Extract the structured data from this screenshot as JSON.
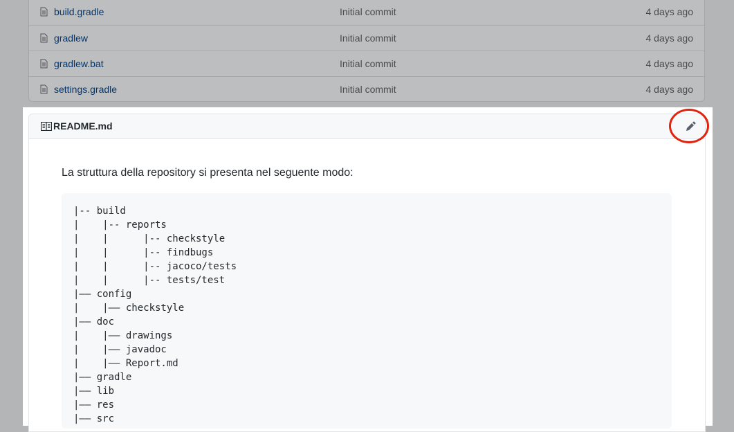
{
  "files": [
    {
      "name": "build.gradle",
      "message": "Initial commit",
      "age": "4 days ago"
    },
    {
      "name": "gradlew",
      "message": "Initial commit",
      "age": "4 days ago"
    },
    {
      "name": "gradlew.bat",
      "message": "Initial commit",
      "age": "4 days ago"
    },
    {
      "name": "settings.gradle",
      "message": "Initial commit",
      "age": "4 days ago"
    }
  ],
  "readme": {
    "title": "README.md",
    "intro": "La struttura della repository si presenta nel seguente modo:",
    "tree": "|-- build\n|    |-- reports\n|    |      |-- checkstyle\n|    |      |-- findbugs\n|    |      |-- jacoco/tests\n|    |      |-- tests/test\n|—— config\n|    |—— checkstyle\n|—— doc\n|    |—— drawings\n|    |—— javadoc\n|    |—— Report.md\n|—— gradle\n|—— lib\n|—— res\n|—— src"
  },
  "icons": {
    "file": "file-icon",
    "book": "book-icon",
    "edit": "pencil-icon"
  },
  "colors": {
    "link": "#0366d6",
    "highlight_circle": "#e0230e"
  }
}
